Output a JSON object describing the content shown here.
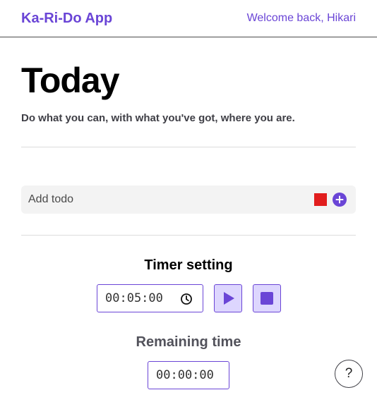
{
  "header": {
    "brand": "Ka-Ri-Do App",
    "welcome": "Welcome back, Hikari"
  },
  "page": {
    "title": "Today",
    "subtitle": "Do what you can, with what you've got, where you are."
  },
  "todo": {
    "placeholder": "Add todo",
    "selected_color": "#e11d1d",
    "add_icon": "plus-circle-icon"
  },
  "timer": {
    "heading": "Timer setting",
    "setting_value": "00:05:00",
    "setting_icon": "clock-icon",
    "play_icon": "play-icon",
    "stop_icon": "stop-icon",
    "remaining_heading": "Remaining time",
    "remaining_value": "00:00:00"
  },
  "help": {
    "label": "?"
  },
  "colors": {
    "accent": "#6a45d6",
    "button_fill": "#ddd6fe",
    "todo_bar": "#f3f3f3"
  }
}
